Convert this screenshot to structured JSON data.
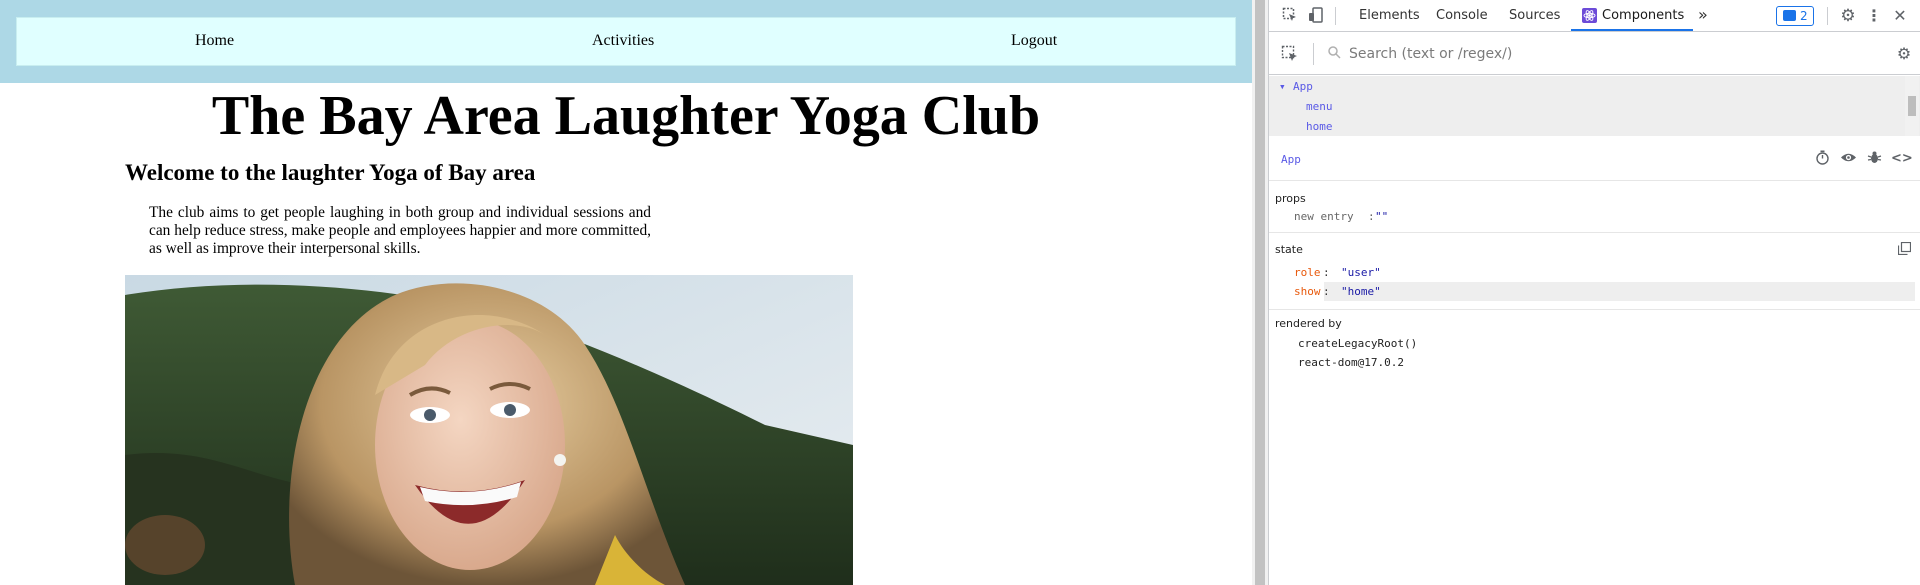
{
  "page": {
    "nav": {
      "home": "Home",
      "activities": "Activities",
      "logout": "Logout"
    },
    "title": "The Bay Area Laughter Yoga Club",
    "welcome": "Welcome to the laughter Yoga of Bay area",
    "description": "The club aims to get people laughing in both group and individual sessions and can help reduce stress, make people and employees happier and more committed, as well as improve their interpersonal skills.",
    "colors": {
      "nav_outer": "#add8e6",
      "nav_inner": "#e0ffff"
    }
  },
  "devtools": {
    "tabs": [
      "Elements",
      "Console",
      "Sources",
      "Components"
    ],
    "active_tab": "Components",
    "more_tabs_glyph": "»",
    "issues_count": "2",
    "search_placeholder": "Search (text or /regex/)",
    "tree": {
      "root": "App",
      "children": [
        "menu",
        "home"
      ]
    },
    "selected_component": "App",
    "props": {
      "title": "props",
      "entries": [
        {
          "key": "new entry",
          "value": "\"\""
        }
      ]
    },
    "state": {
      "title": "state",
      "entries": [
        {
          "key": "role",
          "value": "\"user\""
        },
        {
          "key": "show",
          "value": "\"home\""
        }
      ]
    },
    "rendered_by": {
      "title": "rendered by",
      "items": [
        "createLegacyRoot()",
        "react-dom@17.0.2"
      ]
    },
    "colors": {
      "accent": "#1a73e8",
      "component_name": "#5a5ae6",
      "state_key": "#e8590c",
      "string_value": "#1a1aa6"
    }
  }
}
